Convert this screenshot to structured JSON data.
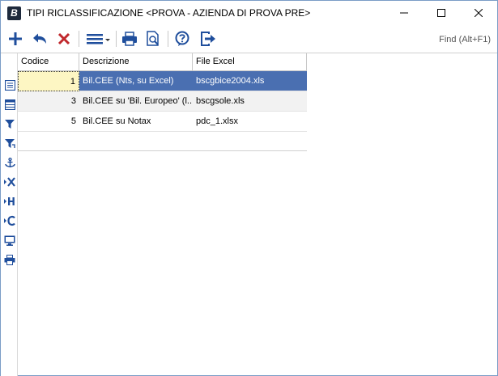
{
  "window": {
    "title": "TIPI RICLASSIFICAZIONE <PROVA - AZIENDA DI PROVA PRE>",
    "app_icon_letter": "B"
  },
  "toolbar": {
    "find_placeholder": "Find (Alt+F1)",
    "icons": [
      "add-icon",
      "undo-icon",
      "delete-icon",
      "menu-icon",
      "print-icon",
      "print-preview-icon",
      "help-icon",
      "exit-icon"
    ],
    "colors": {
      "primary": "#1f4e9c",
      "delete": "#c0282c"
    }
  },
  "side_strip": {
    "icons": [
      "list-icon",
      "grid-icon",
      "filter-icon",
      "filter-apply-icon",
      "anchor-icon",
      "clear-x-icon",
      "h-icon",
      "c-icon",
      "monitor-icon",
      "printer-icon"
    ]
  },
  "grid": {
    "columns": [
      "Codice",
      "Descrizione",
      "File Excel"
    ],
    "rows": [
      {
        "codice": "1",
        "descrizione": "Bil.CEE  (Nts, su Excel)",
        "file_excel": "bscgbice2004.xls"
      },
      {
        "codice": "3",
        "descrizione": "Bil.CEE su 'Bil. Europeo' (l...",
        "file_excel": "bscgsole.xls"
      },
      {
        "codice": "5",
        "descrizione": "Bil.CEE su Notax",
        "file_excel": "pdc_1.xlsx"
      }
    ],
    "selected_color": "#4a6fb1",
    "current_cell_color": "#fdf6c3"
  }
}
